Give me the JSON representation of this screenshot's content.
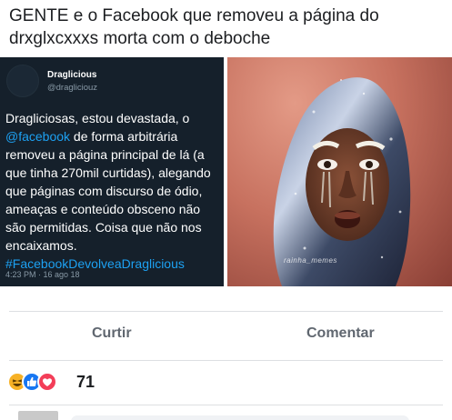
{
  "post": {
    "text": "GENTE e o Facebook que removeu a página do drxglxcxxxs morta com o deboche"
  },
  "tweet": {
    "name": "Draglicious",
    "handle": "@dragliciouz",
    "body_before": "Dragliciosas, estou devastada, o ",
    "mention": "@facebook",
    "body_after": " de forma arbitrária removeu a página principal de lá (a que tinha 270mil curtidas), alegando que páginas com discurso de ódio, ameaças e conteúdo obsceno não são permitidas. Coisa que não nos encaixamos.",
    "hashtag": "#FacebookDevolveaDraglicious",
    "timestamp": "4:23 PM · 16 ago 18"
  },
  "photo": {
    "watermark": "rainha_memes"
  },
  "actions": {
    "like_label": "Curtir",
    "comment_label": "Comentar"
  },
  "reactions": {
    "icons": [
      "haha-icon",
      "like-icon",
      "love-icon"
    ],
    "count": "71",
    "colors": {
      "haha": "#f7b125",
      "like": "#1877f2",
      "love": "#f33e58"
    }
  }
}
